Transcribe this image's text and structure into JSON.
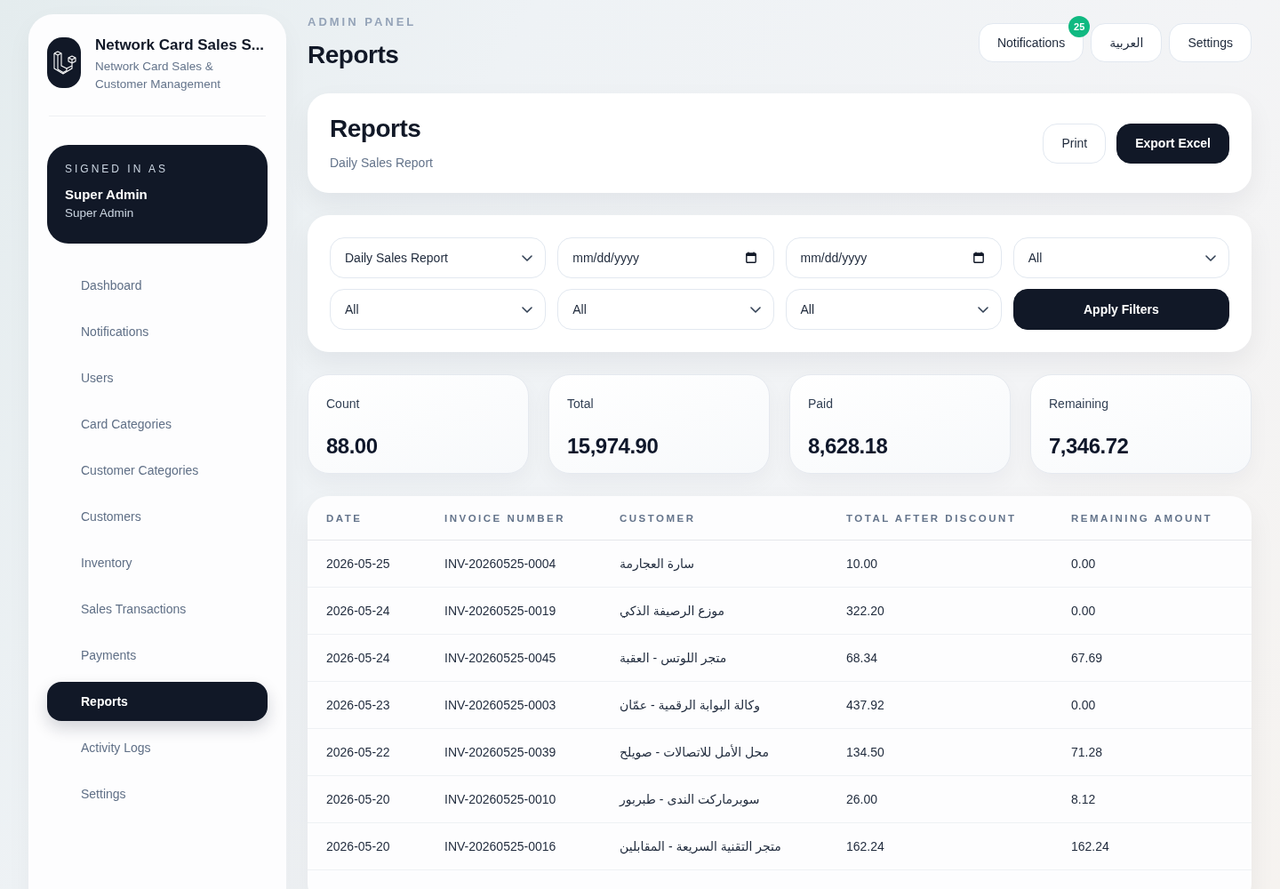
{
  "sidebar": {
    "brand": {
      "title": "Network Card Sales S...",
      "subtitle": "Network Card Sales & Customer Management"
    },
    "user_card": {
      "label": "SIGNED IN AS",
      "name": "Super Admin",
      "role": "Super Admin"
    },
    "nav_items": [
      {
        "label": "Dashboard",
        "selected": false
      },
      {
        "label": "Notifications",
        "selected": false
      },
      {
        "label": "Users",
        "selected": false
      },
      {
        "label": "Card Categories",
        "selected": false
      },
      {
        "label": "Customer Categories",
        "selected": false
      },
      {
        "label": "Customers",
        "selected": false
      },
      {
        "label": "Inventory",
        "selected": false
      },
      {
        "label": "Sales Transactions",
        "selected": false
      },
      {
        "label": "Payments",
        "selected": false
      },
      {
        "label": "Reports",
        "selected": true
      },
      {
        "label": "Activity Logs",
        "selected": false
      },
      {
        "label": "Settings",
        "selected": false
      }
    ]
  },
  "header": {
    "eyebrow": "ADMIN PANEL",
    "title": "Reports",
    "buttons": [
      {
        "label": "Notifications",
        "badge": "25"
      },
      {
        "label": "العربية"
      },
      {
        "label": "Settings"
      }
    ]
  },
  "report_card": {
    "title": "Reports",
    "subtitle": "Daily Sales Report",
    "buttons": [
      {
        "label": "Print",
        "kind": "outline"
      },
      {
        "label": "Export Excel",
        "kind": "primary"
      }
    ]
  },
  "filters": [
    {
      "kind": "select",
      "value": "Daily Sales Report"
    },
    {
      "kind": "date",
      "placeholder": "mm/dd/yyyy"
    },
    {
      "kind": "date",
      "placeholder": "mm/dd/yyyy"
    },
    {
      "kind": "select",
      "value": "All"
    },
    {
      "kind": "select",
      "value": "All"
    },
    {
      "kind": "select",
      "value": "All"
    },
    {
      "kind": "select",
      "value": "All"
    },
    {
      "kind": "button",
      "label": "Apply Filters"
    }
  ],
  "stats": [
    {
      "label": "Count",
      "value": "88.00"
    },
    {
      "label": "Total",
      "value": "15,974.90"
    },
    {
      "label": "Paid",
      "value": "8,628.18"
    },
    {
      "label": "Remaining",
      "value": "7,346.72"
    }
  ],
  "table": {
    "columns": [
      "DATE",
      "INVOICE NUMBER",
      "CUSTOMER",
      "TOTAL AFTER DISCOUNT",
      "REMAINING AMOUNT"
    ],
    "rows": [
      [
        "2026-05-25",
        "INV-20260525-0004",
        "سارة العجارمة",
        "10.00",
        "0.00"
      ],
      [
        "2026-05-24",
        "INV-20260525-0019",
        "موزع الرصيفة الذكي",
        "322.20",
        "0.00"
      ],
      [
        "2026-05-24",
        "INV-20260525-0045",
        "متجر اللوتس - العقبة",
        "68.34",
        "67.69"
      ],
      [
        "2026-05-23",
        "INV-20260525-0003",
        "وكالة البوابة الرقمية - عمّان",
        "437.92",
        "0.00"
      ],
      [
        "2026-05-22",
        "INV-20260525-0039",
        "محل الأمل للاتصالات - صويلح",
        "134.50",
        "71.28"
      ],
      [
        "2026-05-20",
        "INV-20260525-0010",
        "سوبرماركت الندى - طبربور",
        "26.00",
        "8.12"
      ],
      [
        "2026-05-20",
        "INV-20260525-0016",
        "متجر التقنية السريعة - المقابلين",
        "162.24",
        "162.24"
      ]
    ]
  }
}
